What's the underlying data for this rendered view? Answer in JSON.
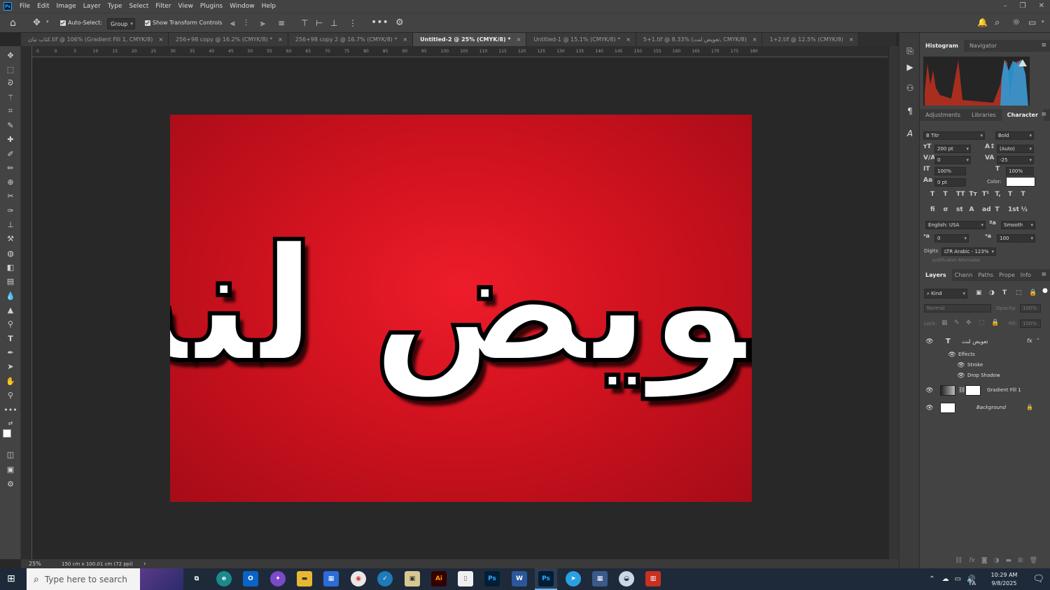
{
  "app": {
    "name": "Photoshop",
    "logo_text": "Ps"
  },
  "menu": [
    "File",
    "Edit",
    "Image",
    "Layer",
    "Type",
    "Select",
    "Filter",
    "View",
    "Plugins",
    "Window",
    "Help"
  ],
  "window_controls": [
    "minimize-icon",
    "restore-icon",
    "close-icon"
  ],
  "options_bar": {
    "auto_select_label": "Auto-Select:",
    "auto_select_checked": true,
    "group_value": "Group",
    "show_transform_label": "Show Transform Controls",
    "show_transform_checked": true
  },
  "tabs": [
    {
      "label": "كتاب تيان.tif @ 106% (Gradient Fill 1, CMYK/8)",
      "active": false
    },
    {
      "label": "256+98 copy @ 16.2% (CMYK/8) *",
      "active": false
    },
    {
      "label": "256+98 copy 2 @ 16.7% (CMYK/8) *",
      "active": false
    },
    {
      "label": "Untitled-2 @ 25% (CMYK/8) *",
      "active": true
    },
    {
      "label": "Untitled-1 @ 15.1% (CMYK/8) *",
      "active": false
    },
    {
      "label": "5+1.tif @ 8.33% (تعویض لنت, CMYK/8)",
      "active": false
    },
    {
      "label": "1+2.tif @ 12.5% (CMYK/8)",
      "active": false
    }
  ],
  "ruler_labels": [
    "-5",
    "0",
    "5",
    "10",
    "15",
    "20",
    "25",
    "30",
    "35",
    "40",
    "45",
    "50",
    "55",
    "60",
    "65",
    "70",
    "75",
    "80",
    "85",
    "90",
    "95",
    "100",
    "105",
    "110",
    "115",
    "120",
    "125",
    "130",
    "135",
    "140",
    "145",
    "150",
    "155",
    "160",
    "165",
    "170",
    "175",
    "180"
  ],
  "canvas": {
    "text": "تعویض لنت",
    "bg_color": "#e31b23",
    "text_color": "#ffffff"
  },
  "status": {
    "zoom": "25%",
    "doc_size": "150 cm x 100.01 cm (72 ppi)"
  },
  "panel_histogram": {
    "tabs": [
      "Histogram",
      "Navigator"
    ],
    "active": "Histogram"
  },
  "panel_character": {
    "tabs": [
      "Adjustments",
      "Libraries",
      "Character"
    ],
    "active": "Character",
    "font_family": "B Titr",
    "font_style": "Bold",
    "font_size": "200 pt",
    "leading": "(Auto)",
    "kerning": "0",
    "tracking": "-25",
    "vertical_scale": "100%",
    "horizontal_scale": "100%",
    "baseline_shift": "0 pt",
    "color_label": "Color:",
    "color": "#ffffff",
    "language": "English: USA",
    "antialias": "Smooth",
    "hyphen_a": "0",
    "hyphen_b": "100",
    "digits_label": "Digits",
    "digits_value": "LTR Arabic - 123%",
    "justification_alt": "Justification Alternates",
    "style_buttons": [
      "T",
      "T",
      "TT",
      "Tт",
      "T¹",
      "T,",
      "T",
      "T"
    ],
    "opentype_buttons": [
      "fi",
      "ơ",
      "st",
      "A",
      "ad",
      "T",
      "1st",
      "½"
    ]
  },
  "panel_layers": {
    "tabs": [
      "Layers",
      "Chann",
      "Paths",
      "Prope",
      "Info"
    ],
    "active": "Layers",
    "filter_kind": "Kind",
    "blend_mode": "Normal",
    "opacity_label": "Opacity:",
    "opacity_value": "100%",
    "lock_label": "Lock:",
    "fill_label": "Fill:",
    "fill_value": "100%",
    "layers": [
      {
        "name": "تعویض لنت",
        "type": "text",
        "fx": "fx",
        "visible": true
      },
      {
        "name": "Effects",
        "type": "effects-group",
        "visible": true
      },
      {
        "name": "Stroke",
        "type": "effect",
        "visible": true
      },
      {
        "name": "Drop Shadow",
        "type": "effect",
        "visible": true
      },
      {
        "name": "Gradient Fill 1",
        "type": "fill",
        "visible": true
      },
      {
        "name": "Background",
        "type": "background",
        "locked": true,
        "visible": true
      }
    ]
  },
  "taskbar": {
    "search_placeholder": "Type here to search",
    "apps": [
      "Ai",
      "Ps",
      "W",
      "Ps"
    ],
    "time": "10:29 AM",
    "date": "9/8/2025",
    "lang": "FA"
  }
}
